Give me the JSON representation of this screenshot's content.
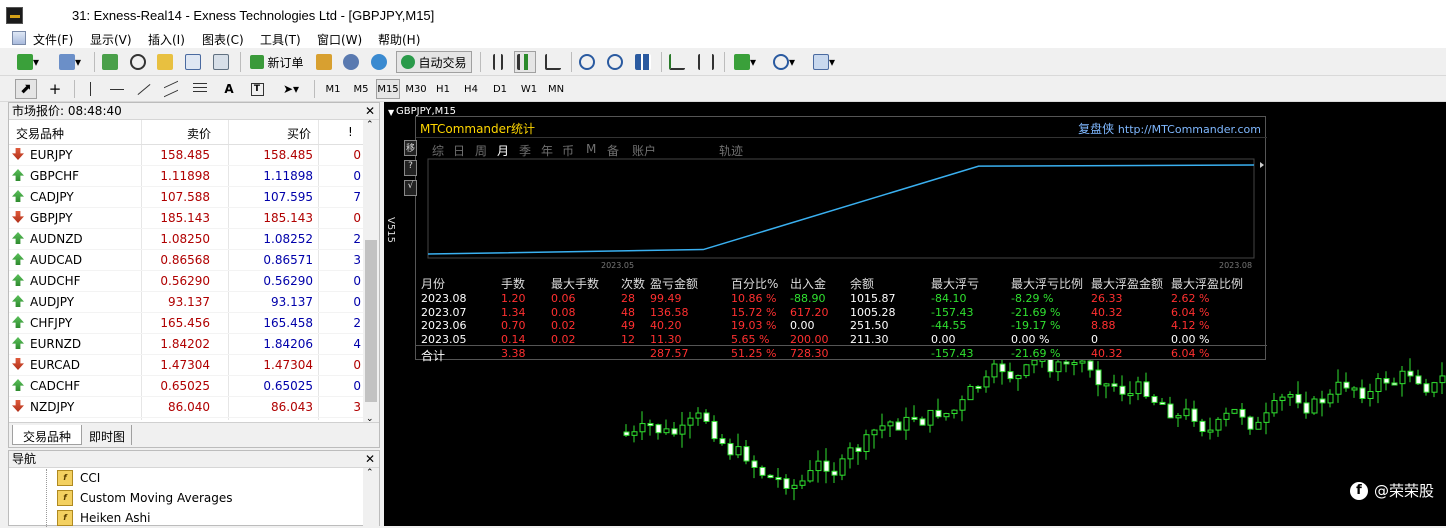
{
  "window": {
    "title": "31: Exness-Real14 - Exness Technologies Ltd - [GBPJPY,M15]"
  },
  "menu": [
    "文件(F)",
    "显示(V)",
    "插入(I)",
    "图表(C)",
    "工具(T)",
    "窗口(W)",
    "帮助(H)"
  ],
  "toolbar": {
    "new_order": "新订单",
    "auto_trading": "自动交易"
  },
  "timeframes": [
    "M1",
    "M5",
    "M15",
    "M30",
    "H1",
    "H4",
    "D1",
    "W1",
    "MN"
  ],
  "market_watch": {
    "title": "市场报价: 08:48:40",
    "columns": [
      "交易品种",
      "卖价",
      "买价",
      "!"
    ],
    "rows": [
      {
        "symbol": "EURJPY",
        "dir": "down",
        "bid": "158.485",
        "ask": "158.485",
        "spread": "0"
      },
      {
        "symbol": "GBPCHF",
        "dir": "up",
        "bid": "1.11898",
        "ask": "1.11898",
        "spread": "0"
      },
      {
        "symbol": "CADJPY",
        "dir": "up",
        "bid": "107.588",
        "ask": "107.595",
        "spread": "7"
      },
      {
        "symbol": "GBPJPY",
        "dir": "down",
        "bid": "185.143",
        "ask": "185.143",
        "spread": "0"
      },
      {
        "symbol": "AUDNZD",
        "dir": "up",
        "bid": "1.08250",
        "ask": "1.08252",
        "spread": "2"
      },
      {
        "symbol": "AUDCAD",
        "dir": "up",
        "bid": "0.86568",
        "ask": "0.86571",
        "spread": "3"
      },
      {
        "symbol": "AUDCHF",
        "dir": "up",
        "bid": "0.56290",
        "ask": "0.56290",
        "spread": "0"
      },
      {
        "symbol": "AUDJPY",
        "dir": "up",
        "bid": "93.137",
        "ask": "93.137",
        "spread": "0"
      },
      {
        "symbol": "CHFJPY",
        "dir": "up",
        "bid": "165.456",
        "ask": "165.458",
        "spread": "2"
      },
      {
        "symbol": "EURNZD",
        "dir": "up",
        "bid": "1.84202",
        "ask": "1.84206",
        "spread": "4"
      },
      {
        "symbol": "EURCAD",
        "dir": "down",
        "bid": "1.47304",
        "ask": "1.47304",
        "spread": "0"
      },
      {
        "symbol": "CADCHF",
        "dir": "up",
        "bid": "0.65025",
        "ask": "0.65025",
        "spread": "0"
      },
      {
        "symbol": "NZDJPY",
        "dir": "down",
        "bid": "86.040",
        "ask": "86.043",
        "spread": "3"
      }
    ],
    "tabs": [
      "交易品种",
      "即时图"
    ]
  },
  "navigator": {
    "title": "导航",
    "items": [
      "CCI",
      "Custom Moving Averages",
      "Heiken Ashi"
    ]
  },
  "chart": {
    "label": "GBPJPY,M15"
  },
  "stats": {
    "title": "MTCommander统计",
    "brand": "复盘侠",
    "url": "http://MTCommander.com",
    "side_buttons": [
      "移",
      "?",
      "√"
    ],
    "version": "V515",
    "period_tabs": [
      "综",
      "日",
      "周",
      "月",
      "季",
      "年",
      "币",
      "M",
      "备",
      "账户",
      "轨迹"
    ],
    "active_tab": "月",
    "axis_start": "2023.05",
    "axis_end": "2023.08",
    "columns": [
      "月份",
      "手数",
      "最大手数",
      "次数",
      "盈亏金额",
      "百分比%",
      "出入金",
      "余额",
      "最大浮亏",
      "最大浮亏比例",
      "最大浮盈金额",
      "最大浮盈比例"
    ],
    "rows": [
      [
        "2023.08",
        "1.20",
        "0.06",
        "28",
        "99.49",
        "10.86 %",
        "-88.90",
        "1015.87",
        "-84.10",
        "-8.29 %",
        "26.33",
        "2.62 %"
      ],
      [
        "2023.07",
        "1.34",
        "0.08",
        "48",
        "136.58",
        "15.72 %",
        "617.20",
        "1005.28",
        "-157.43",
        "-21.69 %",
        "40.32",
        "6.04 %"
      ],
      [
        "2023.06",
        "0.70",
        "0.02",
        "49",
        "40.20",
        "19.03 %",
        "0.00",
        "251.50",
        "-44.55",
        "-19.17 %",
        "8.88",
        "4.12 %"
      ],
      [
        "2023.05",
        "0.14",
        "0.02",
        "12",
        "11.30",
        "5.65 %",
        "200.00",
        "211.30",
        "0.00",
        "0.00 %",
        "0",
        "0.00 %"
      ]
    ],
    "total": [
      "合计",
      "3.38",
      "",
      "",
      "287.57",
      "51.25 %",
      "728.30",
      "",
      "-157.43",
      "-21.69 %",
      "40.32",
      "6.04 %"
    ],
    "equity_curve": {
      "x": [
        "2023.05",
        "2023.06",
        "2023.07",
        "2023.08"
      ],
      "y": [
        211.3,
        251.5,
        1005.28,
        1015.87
      ]
    }
  },
  "watermark": "@荣荣股",
  "colors": {
    "red": "#ff3030",
    "green": "#30e030",
    "white": "#ffffff",
    "curve": "#3ab0f0"
  }
}
